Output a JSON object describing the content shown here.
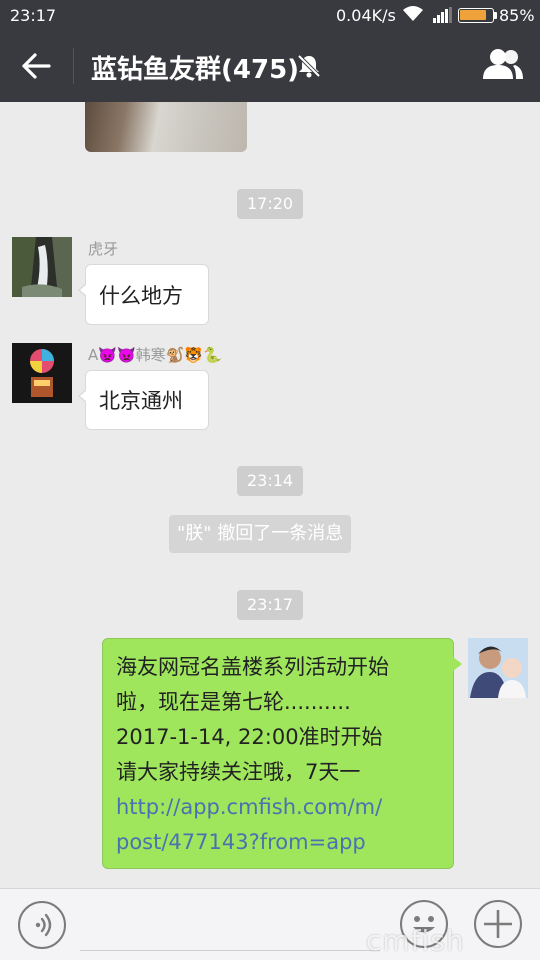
{
  "status_bar": {
    "time": "23:17",
    "network_speed": "0.04K/s",
    "battery_percent": "85%",
    "battery_level": 0.85,
    "battery_color": "#f0a23a"
  },
  "header": {
    "title": "蓝钻鱼友群(475)",
    "icons": {
      "back": "back-arrow-icon",
      "mute": "mute-bell-icon",
      "members": "group-members-icon"
    }
  },
  "timestamps": {
    "t1": "17:20",
    "t2": "23:14",
    "t3": "23:17"
  },
  "messages": [
    {
      "sender": "虎牙",
      "text": "什么地方"
    },
    {
      "sender_prefix": "A",
      "sender_name": "韩寒",
      "sender_emoji": "👿👿",
      "sender_suffix_emoji": "🐒🐯🐍",
      "text": "北京通州"
    }
  ],
  "system_notice": "\"朕\" 撤回了一条消息",
  "my_message": {
    "lines": [
      "海友网冠名盖楼系列活动开始",
      "啦，现在是第七轮..........",
      "2017-1-14, 22:00准时开始",
      "请大家持续关注哦，7天一"
    ],
    "link_lines": [
      "http://app.cmfish.com/m/",
      "post/477143?from=app"
    ]
  },
  "input_bar": {
    "icons": {
      "voice": "voice-icon",
      "emoji": "emoji-icon",
      "more": "plus-icon"
    }
  },
  "watermark": "cmfish",
  "colors": {
    "bar": "#393a3f",
    "my_bubble": "#9fe65d",
    "link": "#4a72b0",
    "chat_bg": "#ebebeb"
  }
}
